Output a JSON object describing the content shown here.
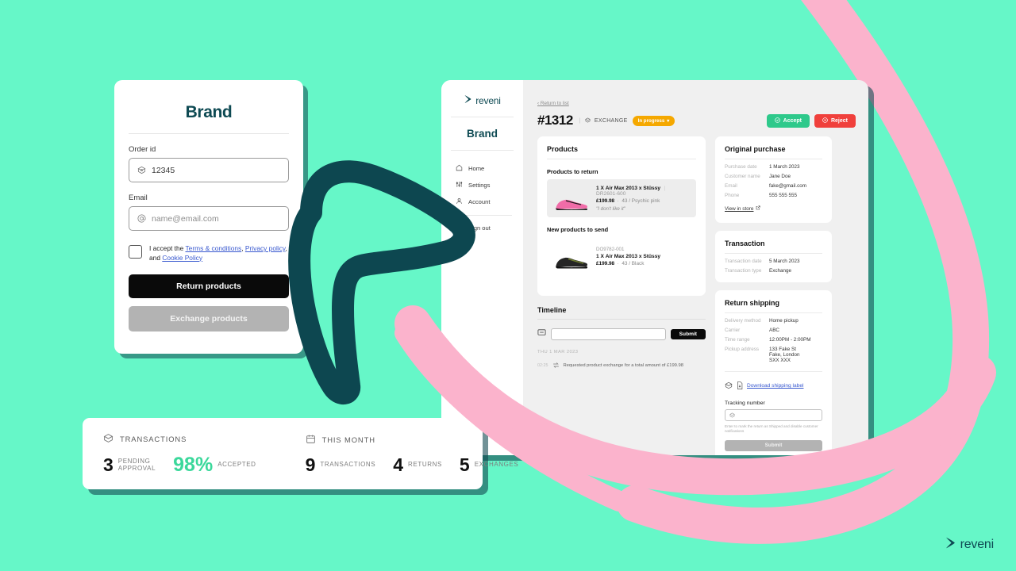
{
  "colors": {
    "background_mint": "#66F7C8",
    "dark_teal": "#0E4A53",
    "pink_ribbon": "#FBB3CC",
    "accent_green": "#2EC98B",
    "accent_red": "#F0403C",
    "badge_amber": "#F5A800",
    "stat_green": "#3BD89B"
  },
  "brand_form": {
    "title": "Brand",
    "order_id_label": "Order id",
    "order_id_value": "12345",
    "order_id_icon": "box-icon",
    "email_label": "Email",
    "email_placeholder": "name@email.com",
    "email_icon": "at-icon",
    "terms_prefix": "I accept the ",
    "terms_link": "Terms & conditions",
    "terms_comma": ", ",
    "privacy_link": "Privacy policy",
    "terms_and": ", and ",
    "cookie_link": "Cookie Policy",
    "return_button": "Return products",
    "exchange_button": "Exchange products"
  },
  "dashboard": {
    "sidebar": {
      "logo_word": "reveni",
      "brand": "Brand",
      "nav": [
        {
          "label": "Home",
          "icon": "home-icon"
        },
        {
          "label": "Settings",
          "icon": "sliders-icon"
        },
        {
          "label": "Account",
          "icon": "person-icon"
        },
        {
          "label": "Sign out",
          "icon": "sign-out-icon"
        }
      ]
    },
    "header": {
      "return_link": "Return to list",
      "order_number": "#1312",
      "pipe": "|",
      "type_label": "EXCHANGE",
      "type_icon": "box-icon",
      "status_badge": "In progress",
      "accept_label": "Accept",
      "reject_label": "Reject"
    },
    "products_card": {
      "title": "Products",
      "return_section_title": "Products to return",
      "return_items": [
        {
          "qty": "1 X",
          "name": "Air Max 2013 x Stüssy",
          "sku": "DR2601-600",
          "price": "£199.98",
          "variant": "43 / Psychic pink",
          "reason": "\"I don't like it\"",
          "color": "pink"
        }
      ],
      "send_section_title": "New products to send",
      "send_items": [
        {
          "sku_top": "DO9782-001",
          "qty": "1 X",
          "name": "Air Max 2013 x Stüssy",
          "price": "£199.98",
          "variant": "43 / Black",
          "color": "black"
        }
      ]
    },
    "original_purchase": {
      "title": "Original purchase",
      "rows": [
        {
          "key": "Purchase date",
          "value": "1 March 2023"
        },
        {
          "key": "Customer name",
          "value": "Jane Doe"
        },
        {
          "key": "Email",
          "value": "fake@gmail.com"
        },
        {
          "key": "Phone",
          "value": "555 555 555"
        }
      ],
      "link": "View in store",
      "link_icon": "external-link-icon"
    },
    "transaction": {
      "title": "Transaction",
      "rows": [
        {
          "key": "Transaction date",
          "value": "5 March 2023"
        },
        {
          "key": "Transaction type",
          "value": "Exchange"
        }
      ]
    },
    "return_shipping": {
      "title": "Return shipping",
      "rows": [
        {
          "key": "Delivery method",
          "value": "Home pickup"
        },
        {
          "key": "Carrier",
          "value": "ABC"
        },
        {
          "key": "Time range",
          "value": "12:00PM - 2:00PM"
        },
        {
          "key": "Pickup address",
          "value": "133 Fake St\nFake, London\nSXX XXX"
        }
      ],
      "download_label": "Download shipping label",
      "download_icon": "shipping-label-icon",
      "tracking_label": "Tracking number",
      "tracking_value": "",
      "tracking_icon": "box-icon",
      "tracking_help": "Enter to mark the return as Shipped and disable customer notifications",
      "submit_label": "Submit"
    },
    "timeline": {
      "title": "Timeline",
      "comment_icon": "comment-icon",
      "comment_value": "",
      "submit_label": "Submit",
      "date_header": "THU 1 MAR 2023",
      "entries": [
        {
          "time": "02:25",
          "icon": "exchange-arrows-icon",
          "text": "Requested product exchange for a total amount of £199.98"
        }
      ]
    }
  },
  "stats_bar": {
    "groups": [
      {
        "head_icon": "box-icon",
        "head_label": "TRANSACTIONS",
        "items": [
          {
            "number": "3",
            "caption": "PENDING\nAPPROVAL",
            "green": false
          },
          {
            "number": "98%",
            "caption": "ACCEPTED",
            "green": true
          }
        ]
      },
      {
        "head_icon": "calendar-icon",
        "head_label": "THIS MONTH",
        "items": [
          {
            "number": "9",
            "caption": "TRANSACTIONS",
            "green": false
          },
          {
            "number": "4",
            "caption": "RETURNS",
            "green": false
          },
          {
            "number": "5",
            "caption": "EXCHANGES",
            "green": false
          }
        ]
      }
    ]
  },
  "corner_logo": {
    "word": "reveni",
    "icon": "reveni-chevron-icon"
  }
}
